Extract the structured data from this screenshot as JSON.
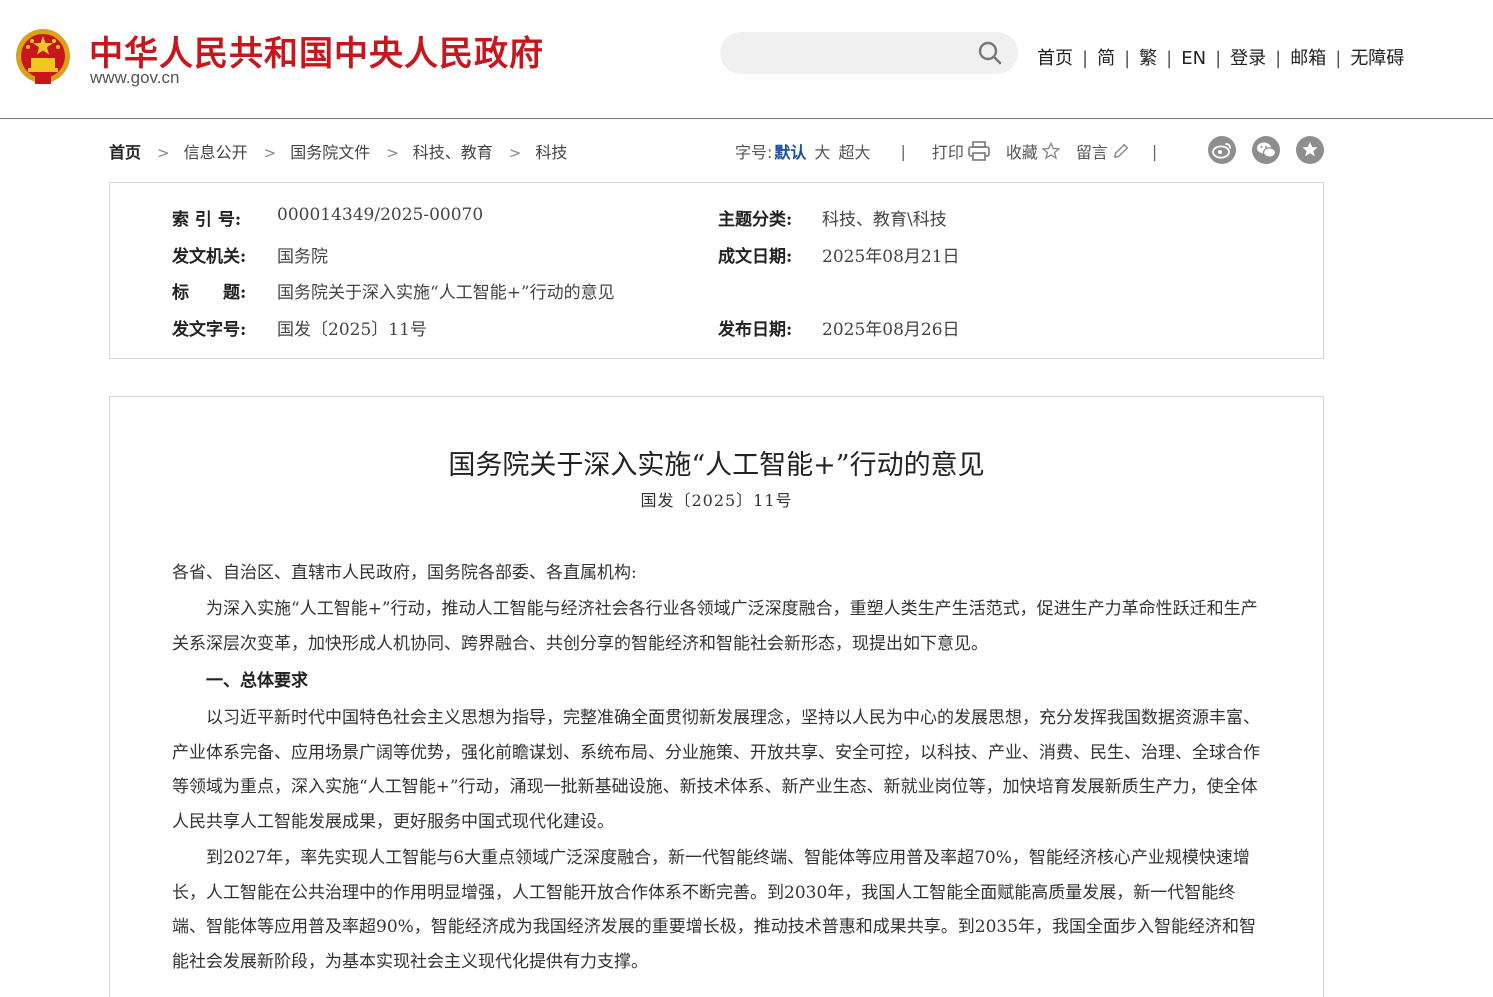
{
  "header": {
    "site_title": "中华人民共和国中央人民政府",
    "site_url": "www.gov.cn",
    "search": {
      "value": "",
      "placeholder": ""
    },
    "nav": [
      "首页",
      "简",
      "繁",
      "EN",
      "登录",
      "邮箱",
      "无障碍"
    ]
  },
  "breadcrumb": [
    "首页",
    "信息公开",
    "国务院文件",
    "科技、教育",
    "科技"
  ],
  "toolbar": {
    "font_size_label": "字号:",
    "font_size_default": "默认",
    "font_size_large": "大",
    "font_size_xlarge": "超大",
    "print_label": "打印",
    "favorite_label": "收藏",
    "comment_label": "留言",
    "share_icons": [
      "weibo-icon",
      "wechat-icon",
      "star-circle-icon"
    ]
  },
  "info": {
    "index_label": "索 引 号:",
    "index_value": "000014349/2025-00070",
    "topic_label": "主题分类:",
    "topic_value": "科技、教育\\科技",
    "issuer_label": "发文机关:",
    "issuer_value": "国务院",
    "date_written_label": "成文日期:",
    "date_written_value": "2025年08月21日",
    "title_label": "标　　题:",
    "title_value": "国务院关于深入实施“人工智能+”行动的意见",
    "doc_no_label": "发文字号:",
    "doc_no_value": "国发〔2025〕11号",
    "pub_date_label": "发布日期:",
    "pub_date_value": "2025年08月26日"
  },
  "article": {
    "title": "国务院关于深入实施“人工智能+”行动的意见",
    "subtitle": "国发〔2025〕11号",
    "addressee": "各省、自治区、直辖市人民政府，国务院各部委、各直属机构:",
    "p1": "为深入实施“人工智能+”行动，推动人工智能与经济社会各行业各领域广泛深度融合，重塑人类生产生活范式，促进生产力革命性跃迁和生产关系深层次变革，加快形成人机协同、跨界融合、共创分享的智能经济和智能社会新形态，现提出如下意见。",
    "heading1": "一、总体要求",
    "p2": "以习近平新时代中国特色社会主义思想为指导，完整准确全面贯彻新发展理念，坚持以人民为中心的发展思想，充分发挥我国数据资源丰富、产业体系完备、应用场景广阔等优势，强化前瞻谋划、系统布局、分业施策、开放共享、安全可控，以科技、产业、消费、民生、治理、全球合作等领域为重点，深入实施“人工智能+”行动，涌现一批新基础设施、新技术体系、新产业生态、新就业岗位等，加快培育发展新质生产力，使全体人民共享人工智能发展成果，更好服务中国式现代化建设。",
    "p3": "到2027年，率先实现人工智能与6大重点领域广泛深度融合，新一代智能终端、智能体等应用普及率超70%，智能经济核心产业规模快速增长，人工智能在公共治理中的作用明显增强，人工智能开放合作体系不断完善。到2030年，我国人工智能全面赋能高质量发展，新一代智能终端、智能体等应用普及率超90%，智能经济成为我国经济发展的重要增长极，推动技术普惠和成果共享。到2035年，我国全面步入智能经济和智能社会发展新阶段，为基本实现社会主义现代化提供有力支撑。"
  },
  "colors": {
    "brand_red": "#c8161d",
    "active_blue": "#1f4fa1",
    "share_gray": "#8e8e8e"
  }
}
